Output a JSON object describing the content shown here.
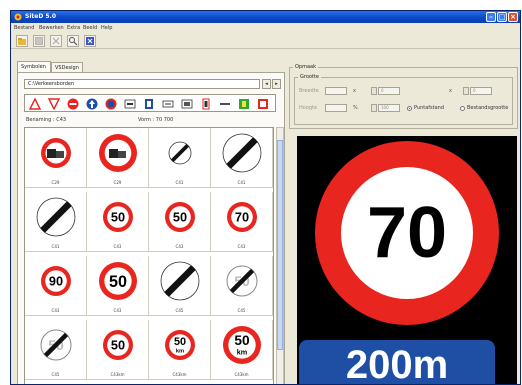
{
  "window": {
    "title": "SiteD 5.0"
  },
  "menu": [
    "Bestand",
    "Bewerken",
    "Extra",
    "Beeld",
    "Help"
  ],
  "toolbar": [
    {
      "icon": "open-icon"
    },
    {
      "icon": "save-icon"
    },
    {
      "icon": "delete-icon"
    },
    {
      "icon": "zoom-icon"
    },
    {
      "icon": "settings-icon"
    }
  ],
  "tabs": [
    "Symbolen",
    "VSDesign"
  ],
  "left": {
    "folder_path": "C:\\Verkeersborden",
    "naming": "Benaming : C43",
    "format": "Vorm : 70 700"
  },
  "categories": [
    {
      "icon": "warning-triangle-icon"
    },
    {
      "icon": "yield-triangle-icon"
    },
    {
      "icon": "no-entry-icon"
    },
    {
      "icon": "mandatory-arrow-icon"
    },
    {
      "icon": "blue-circle-icon"
    },
    {
      "icon": "rectangle-sign-icon"
    },
    {
      "icon": "parking-sign-icon"
    },
    {
      "icon": "direction-sign-icon"
    },
    {
      "icon": "bus-sign-icon"
    },
    {
      "icon": "traffic-light-icon"
    },
    {
      "icon": "line-icon"
    },
    {
      "icon": "green-sign-icon"
    },
    {
      "icon": "red-sign-icon"
    }
  ],
  "signs": [
    {
      "kind": "truck",
      "text": "",
      "caption": "C29"
    },
    {
      "kind": "truck",
      "text": "",
      "caption": "C29"
    },
    {
      "kind": "end",
      "text": "",
      "caption": "C41"
    },
    {
      "kind": "end",
      "text": "",
      "caption": "C41"
    },
    {
      "kind": "end",
      "text": "",
      "caption": "C41"
    },
    {
      "kind": "limit",
      "text": "50",
      "caption": "C43"
    },
    {
      "kind": "limit",
      "text": "50",
      "caption": "C43"
    },
    {
      "kind": "limit",
      "text": "70",
      "caption": "C43"
    },
    {
      "kind": "limit",
      "text": "90",
      "caption": "C43"
    },
    {
      "kind": "limit",
      "text": "50",
      "caption": "C43"
    },
    {
      "kind": "end",
      "text": "",
      "caption": "C45"
    },
    {
      "kind": "endlimit",
      "text": "50",
      "caption": "C45"
    },
    {
      "kind": "endlimit",
      "text": "50",
      "caption": "C45"
    },
    {
      "kind": "limit",
      "text": "50",
      "caption": "C43km"
    },
    {
      "kind": "limitkm",
      "text": "50",
      "unit": "km",
      "caption": "C43km"
    },
    {
      "kind": "limitkm",
      "text": "50",
      "unit": "km",
      "caption": "C43km"
    }
  ],
  "right": {
    "group_label": "Opmaak",
    "sub_label": "Grootte",
    "f1_label": "Breedte",
    "f1_value": "",
    "f2_value": "0",
    "f3_value": "0",
    "row2_label": "Hoogte",
    "f4_value": "",
    "f5_value": "100",
    "radio1": "Puntafstand",
    "radio2": "Bestandsgrootte"
  },
  "preview": {
    "speed": "70",
    "distance": "200m"
  },
  "colors": {
    "sign_red": "#e8261f",
    "plate_blue": "#1f4fa5",
    "title_blue": "#0a49c8"
  }
}
